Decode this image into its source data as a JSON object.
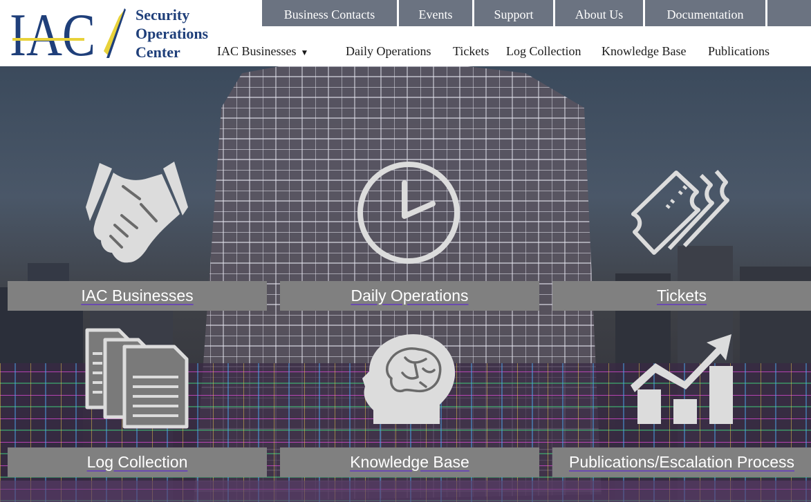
{
  "brand": {
    "logo_text": "IAC",
    "line1": "Security",
    "line2": "Operations",
    "line3": "Center",
    "colors": {
      "navy": "#1f3f7a",
      "accent": "#e8d23a"
    }
  },
  "top_nav": [
    {
      "label": "Business Contacts"
    },
    {
      "label": "Events"
    },
    {
      "label": "Support"
    },
    {
      "label": "About Us"
    },
    {
      "label": "Documentation"
    },
    {
      "label": ""
    }
  ],
  "sub_nav": {
    "dropdown": {
      "label": "IAC Businesses",
      "caret": "▼"
    },
    "links": [
      {
        "label": "Daily Operations"
      },
      {
        "label": "Tickets"
      },
      {
        "label": "Log Collection"
      },
      {
        "label": "Knowledge Base"
      },
      {
        "label": "Publications"
      }
    ]
  },
  "tiles": [
    {
      "label": "IAC Businesses",
      "icon": "handshake-icon"
    },
    {
      "label": "Daily Operations",
      "icon": "clock-icon"
    },
    {
      "label": "Tickets",
      "icon": "tickets-icon"
    },
    {
      "label": "Log Collection",
      "icon": "documents-icon"
    },
    {
      "label": "Knowledge Base",
      "icon": "brain-head-icon"
    },
    {
      "label": "Publications/Escalation Process",
      "icon": "growth-chart-icon"
    }
  ]
}
